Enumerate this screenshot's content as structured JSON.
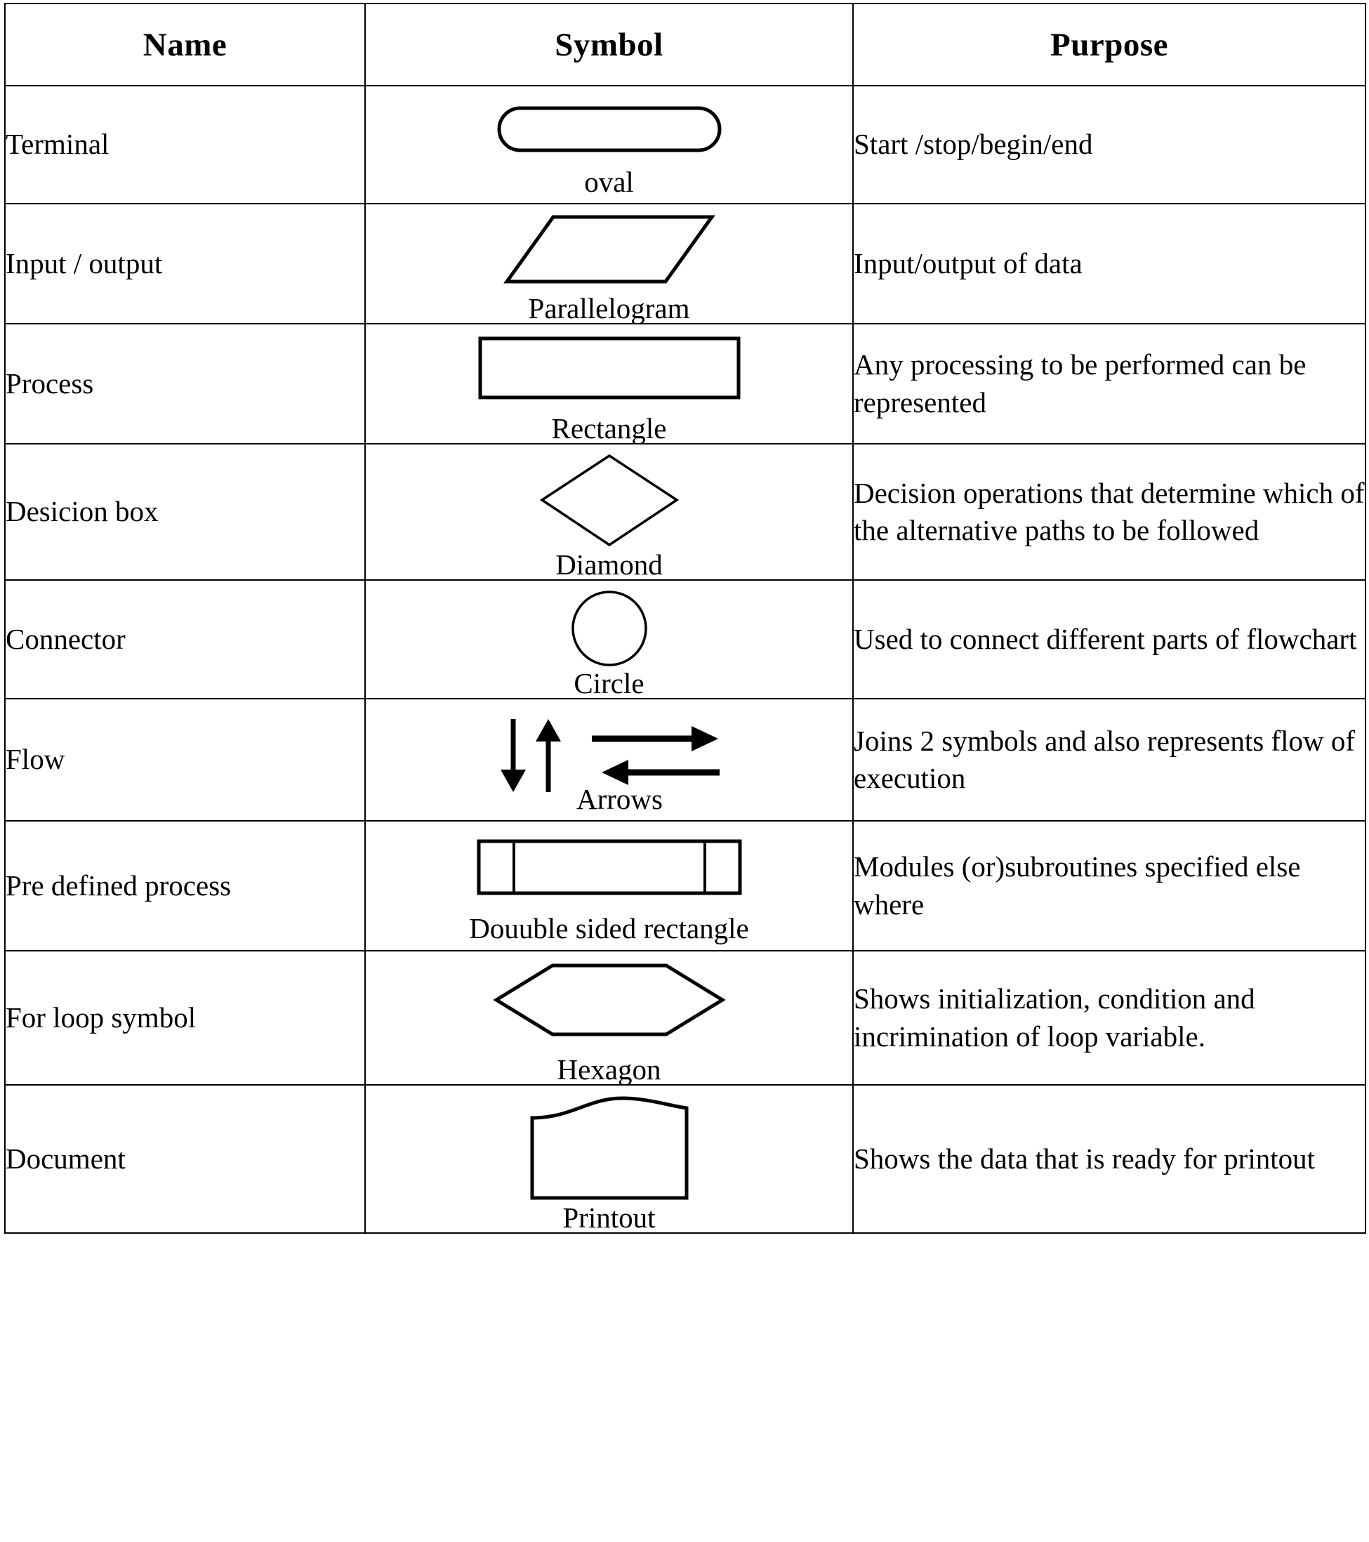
{
  "table": {
    "headers": [
      "Name",
      "Symbol",
      "Purpose"
    ],
    "rows": [
      {
        "name": "Terminal",
        "shape": "oval",
        "shape_label": "oval",
        "purpose": "Start /stop/begin/end"
      },
      {
        "name": "Input / output",
        "shape": "parallelogram",
        "shape_label": "Parallelogram",
        "purpose": "Input/output of data"
      },
      {
        "name": "Process",
        "shape": "rectangle",
        "shape_label": "Rectangle",
        "purpose": "Any processing to be performed can be represented"
      },
      {
        "name": "Desicion box",
        "shape": "diamond",
        "shape_label": "Diamond",
        "purpose": "Decision operations that determine which of the alternative paths to be followed"
      },
      {
        "name": "Connector",
        "shape": "circle",
        "shape_label": "Circle",
        "purpose": "Used to connect different parts of flowchart"
      },
      {
        "name": "Flow",
        "shape": "arrows",
        "shape_label": "Arrows",
        "purpose": "Joins 2 symbols and also represents flow of execution"
      },
      {
        "name": "Pre defined process",
        "shape": "double-sided-rectangle",
        "shape_label": "Douuble sided rectangle",
        "purpose": "Modules (or)subroutines specified else where"
      },
      {
        "name": "For loop symbol",
        "shape": "hexagon",
        "shape_label": "Hexagon",
        "purpose": "Shows initialization, condition and incrimination of loop variable."
      },
      {
        "name": "Document",
        "shape": "printout",
        "shape_label": "Printout",
        "purpose": "Shows the data that is ready for printout"
      }
    ]
  },
  "colors": {
    "ink": "#000000",
    "paper": "#ffffff"
  }
}
